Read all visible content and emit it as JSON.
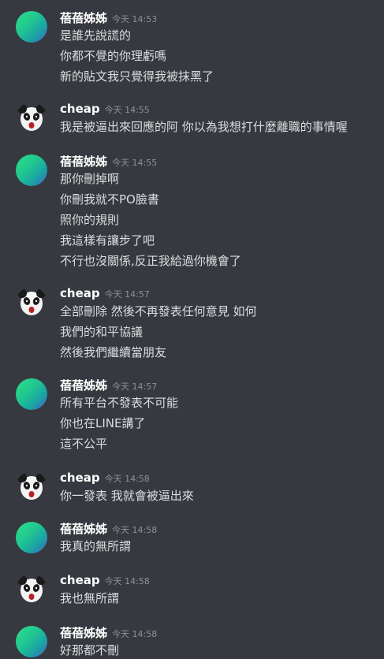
{
  "messages": [
    {
      "author": "蓓蓓姊姊",
      "time": "今天 14:53",
      "avatar": "green-gradient-avatar",
      "lines": [
        "是誰先說謊的",
        "你都不覺的你理虧嗎",
        "新的貼文我只覺得我被抹黑了"
      ]
    },
    {
      "author": "cheap",
      "time": "今天 14:55",
      "avatar": "panda-avatar",
      "lines": [
        "我是被逼出來回應的阿 你以為我想打什麼離職的事情喔"
      ]
    },
    {
      "author": "蓓蓓姊姊",
      "time": "今天 14:55",
      "avatar": "green-gradient-avatar",
      "lines": [
        "那你刪掉啊",
        "你刪我就不PO臉書",
        "照你的規則",
        "我這樣有讓步了吧",
        "不行也沒關係,反正我給過你機會了"
      ]
    },
    {
      "author": "cheap",
      "time": "今天 14:57",
      "avatar": "panda-avatar",
      "lines": [
        "全部刪除 然後不再發表任何意見 如何",
        "我們的和平協議",
        "然後我們繼續當朋友"
      ]
    },
    {
      "author": "蓓蓓姊姊",
      "time": "今天 14:57",
      "avatar": "green-gradient-avatar",
      "lines": [
        "所有平台不發表不可能",
        "你也在LINE講了",
        "這不公平"
      ]
    },
    {
      "author": "cheap",
      "time": "今天 14:58",
      "avatar": "panda-avatar",
      "lines": [
        "你一發表 我就會被逼出來"
      ]
    },
    {
      "author": "蓓蓓姊姊",
      "time": "今天 14:58",
      "avatar": "green-gradient-avatar",
      "lines": [
        "我真的無所謂"
      ]
    },
    {
      "author": "cheap",
      "time": "今天 14:58",
      "avatar": "panda-avatar",
      "lines": [
        "我也無所謂"
      ]
    },
    {
      "author": "蓓蓓姊姊",
      "time": "今天 14:58",
      "avatar": "green-gradient-avatar",
      "lines": [
        "好那都不刪"
      ]
    }
  ]
}
